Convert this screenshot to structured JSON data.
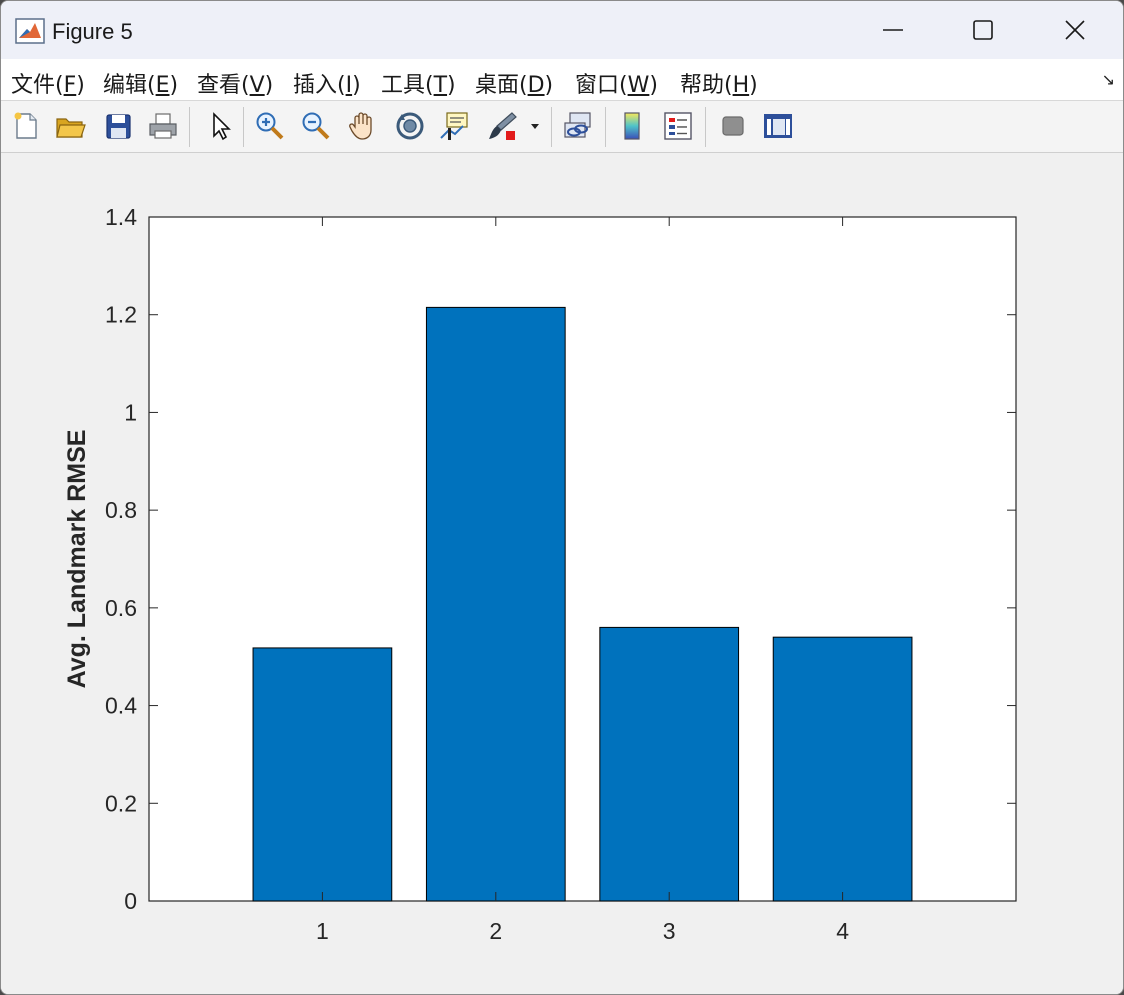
{
  "window": {
    "title": "Figure 5",
    "controls": {
      "minimize": "minimize",
      "maximize": "maximize",
      "close": "close"
    }
  },
  "menubar": {
    "items": [
      {
        "label": "文件(F)",
        "underline": "F"
      },
      {
        "label": "编辑(E)",
        "underline": "E"
      },
      {
        "label": "查看(V)",
        "underline": "V"
      },
      {
        "label": "插入(I)",
        "underline": "I"
      },
      {
        "label": "工具(T)",
        "underline": "T"
      },
      {
        "label": "桌面(D)",
        "underline": "D"
      },
      {
        "label": "窗口(W)",
        "underline": "W"
      },
      {
        "label": "帮助(H)",
        "underline": "H"
      }
    ]
  },
  "toolbar": {
    "buttons": [
      "new-figure-icon",
      "open-file-icon",
      "save-icon",
      "print-icon",
      "edit-plot-arrow-icon",
      "zoom-in-icon",
      "zoom-out-icon",
      "pan-hand-icon",
      "rotate-3d-icon",
      "data-cursor-icon",
      "brush-icon",
      "link-plot-icon",
      "colorbar-icon",
      "legend-icon",
      "hide-plot-tools-icon",
      "show-plot-tools-icon"
    ]
  },
  "chart_data": {
    "type": "bar",
    "categories": [
      "1",
      "2",
      "3",
      "4"
    ],
    "values": [
      0.518,
      1.215,
      0.56,
      0.54
    ],
    "title": "",
    "xlabel": "",
    "ylabel": "Avg. Landmark RMSE",
    "ylim": [
      0,
      1.4
    ],
    "xlim": [
      0,
      5
    ],
    "yticks": [
      "0",
      "0.2",
      "0.4",
      "0.6",
      "0.8",
      "1",
      "1.2",
      "1.4"
    ],
    "ytick_values": [
      0,
      0.2,
      0.4,
      0.6,
      0.8,
      1,
      1.2,
      1.4
    ],
    "bar_color": "#0072bd",
    "bar_edge_color": "#000000",
    "grid": false
  }
}
